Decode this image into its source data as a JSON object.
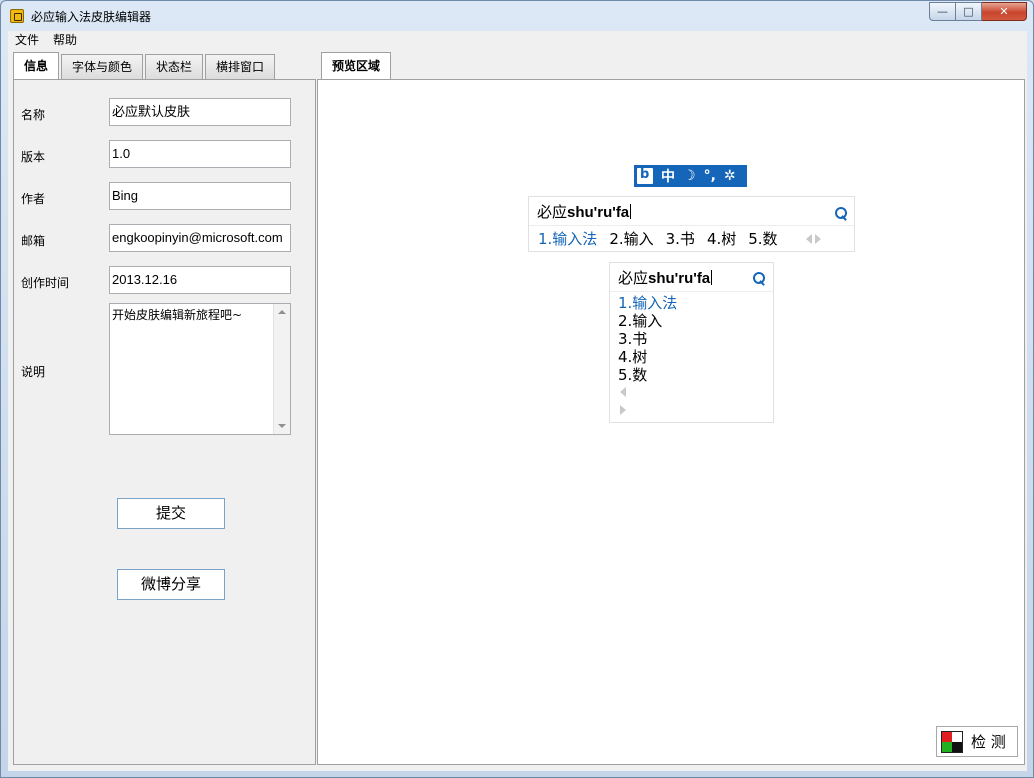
{
  "window": {
    "title": "必应输入法皮肤编辑器",
    "minimize_glyph": "—",
    "maximize_glyph": "□",
    "close_glyph": "✕"
  },
  "menu": [
    "文件",
    "帮助"
  ],
  "left_tabs": [
    {
      "label": "信息",
      "active": true
    },
    {
      "label": "字体与颜色",
      "active": false
    },
    {
      "label": "状态栏",
      "active": false
    },
    {
      "label": "横排窗口",
      "active": false
    }
  ],
  "right_tabs": [
    {
      "label": "预览区域",
      "active": true
    }
  ],
  "info": {
    "name_label": "名称",
    "name_value": "必应默认皮肤",
    "version_label": "版本",
    "version_value": "1.0",
    "author_label": "作者",
    "author_value": "Bing",
    "email_label": "邮箱",
    "email_value": "engkoopinyin@microsoft.com",
    "created_label": "创作时间",
    "created_value": "2013.12.16",
    "desc_label": "说明",
    "desc_value": "开始皮肤编辑新旅程吧~"
  },
  "buttons": {
    "submit": "提交",
    "share": "微博分享",
    "detect": "检 测"
  },
  "preview": {
    "status_bar": {
      "mode": "中",
      "moon": "☽",
      "punct": "°,",
      "gear": "✲"
    },
    "composition_prefix": "必应",
    "composition_pinyin": "shu'ru'fa",
    "candidates": [
      "1.输入法",
      "2.输入",
      "3.书",
      "4.树",
      "5.数"
    ]
  },
  "colors": {
    "accent": "#1565b8",
    "detect_red": "#e02020",
    "detect_green": "#20b020"
  }
}
